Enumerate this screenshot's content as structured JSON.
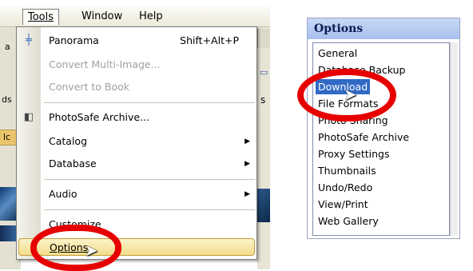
{
  "menubar": {
    "tools": "Tools",
    "window": "Window",
    "help": "Help"
  },
  "background": {
    "frag_a": "a",
    "frag_ds": "ds",
    "frag_s": "s",
    "frag_lc": "lc"
  },
  "tools_menu": {
    "panorama": {
      "label": "Panorama",
      "shortcut": "Shift+Alt+P"
    },
    "convert_multi": "Convert Multi-Image...",
    "convert_book": "Convert to Book",
    "photosafe": "PhotoSafe Archive...",
    "catalog": "Catalog",
    "database": "Database",
    "audio": "Audio",
    "customize": "Customize",
    "options": "Options"
  },
  "options_panel": {
    "title": "Options",
    "items": [
      "General",
      "Database Backup",
      "Download",
      "File Formats",
      "Photo Sharing",
      "PhotoSafe Archive",
      "Proxy Settings",
      "Thumbnails",
      "Undo/Redo",
      "View/Print",
      "Web Gallery"
    ],
    "selected": "Download"
  },
  "colors": {
    "highlight_ring": "#e60000",
    "selection": "#316ac5",
    "options_hover": "#f3dc8a"
  }
}
